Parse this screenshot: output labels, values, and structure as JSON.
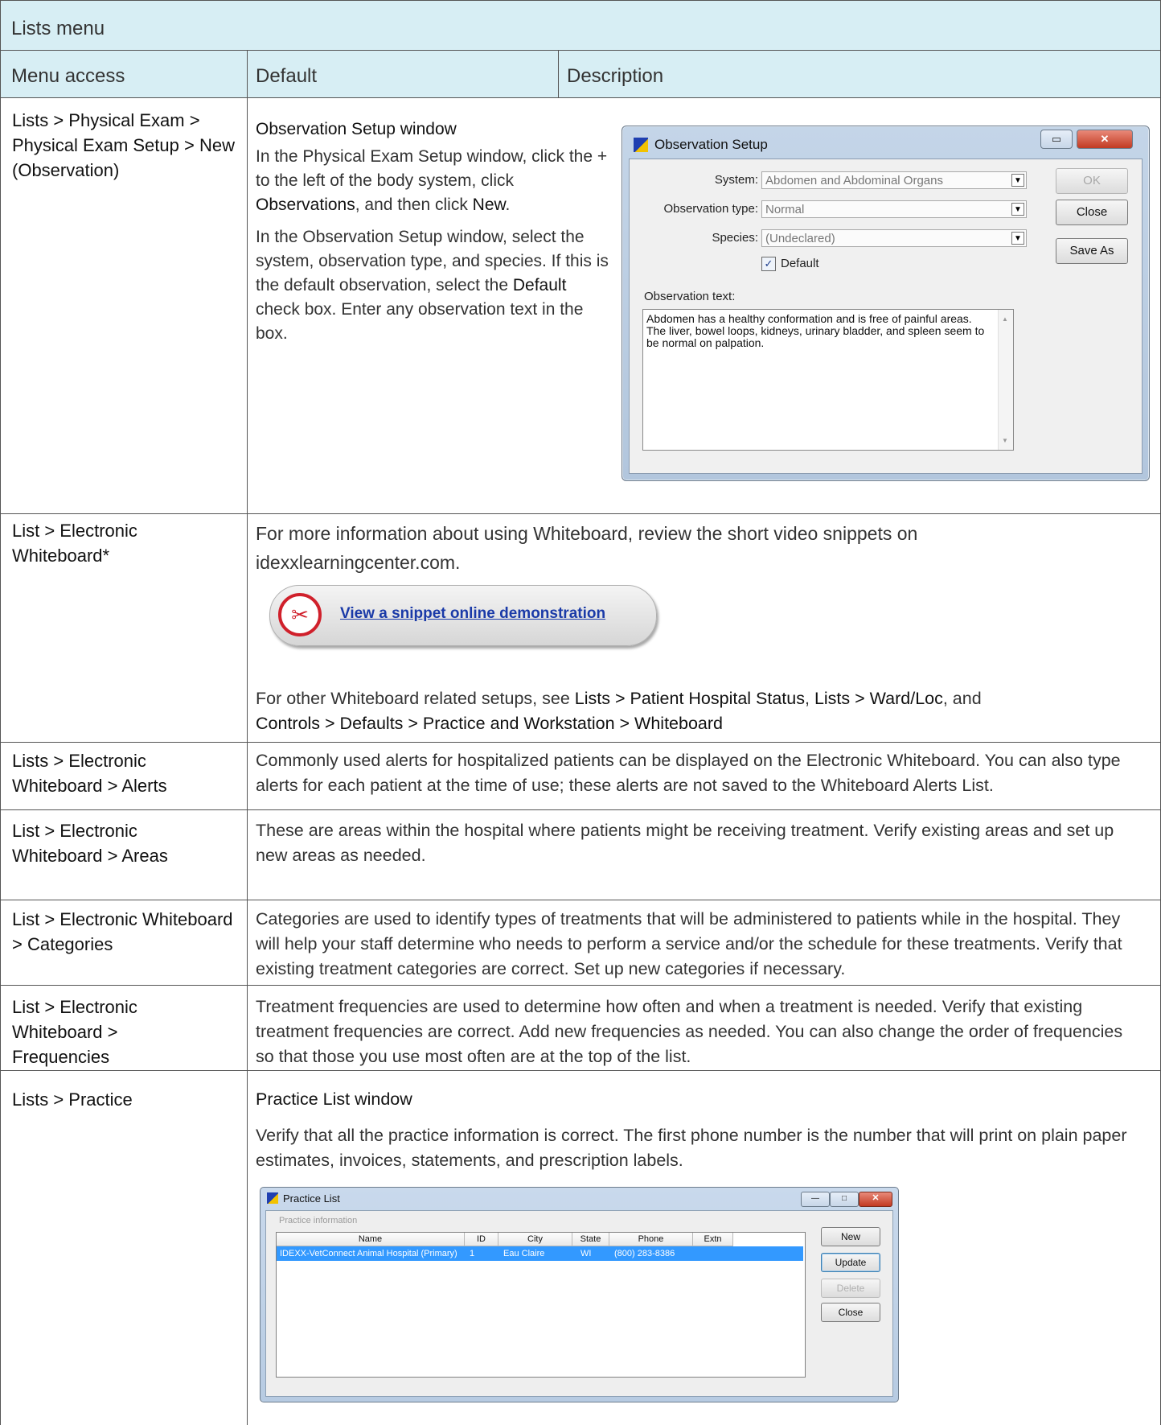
{
  "table": {
    "title": "Lists menu",
    "headers": [
      "Menu access",
      "Default",
      "Description"
    ]
  },
  "rows": {
    "obs": {
      "access": "Lists > Physical Exam > Physical Exam Setup > New (Observation)",
      "heading": "Observation Setup window",
      "p1_a": "In the Physical Exam Setup window, click the + to the left of the body system, click ",
      "p1_b": "Observations",
      "p1_c": ",  and then click ",
      "p1_d": "New",
      "p1_e": ".",
      "p2_a": "In the Observation Setup window, select the system, observation type, and species. If this is the default observation, select the ",
      "p2_b": "Default",
      "p2_c": " check box. Enter any observation text in the box."
    },
    "whiteboard": {
      "access": "List > Electronic Whiteboard*",
      "info": "For more information about using Whiteboard, review the short video snippets on idexxlearningcenter.com.",
      "snippet_link": "View a snippet online demonstration",
      "other_a": "For other Whiteboard related setups, see ",
      "other_b": "Lists > Patient Hospital Status",
      "other_c": ", ",
      "other_d": "Lists > Ward/Loc",
      "other_e": ", and",
      "other_f": "Controls > Defaults > Practice and Workstation > Whiteboard"
    },
    "alerts": {
      "access": "Lists > Electronic Whiteboard > Alerts",
      "text": "Commonly used alerts for hospitalized patients can be displayed on the Electronic Whiteboard. You can also type alerts for each patient at the time of use; these alerts are not saved to the Whiteboard Alerts List."
    },
    "areas": {
      "access": "List > Electronic Whiteboard > Areas",
      "text": "These are areas within the hospital where patients might be receiving treatment. Verify existing areas and set up new areas as needed."
    },
    "categories": {
      "access": "List > Electronic Whiteboard > Categories",
      "text": "Categories are used to identify types of treatments that will be administered to patients while in the hospital. They will help your staff determine who needs to perform a service and/or the schedule for these treatments. Verify that existing treatment categories are correct. Set up new categories if necessary."
    },
    "frequencies": {
      "access": "List > Electronic Whiteboard > Frequencies",
      "text": "Treatment frequencies are used to determine how often and when a treatment is needed. Verify that existing treatment frequencies are correct. Add new frequencies as needed. You can also change the order of frequencies so that those you use most often are at the top of the list."
    },
    "practice": {
      "access": "Lists > Practice",
      "heading": "Practice List window",
      "text": "Verify that all the practice information is correct. The first phone number is the number that will print on plain paper estimates, invoices, statements, and prescription labels."
    }
  },
  "observation_window": {
    "title": "Observation Setup",
    "system_label": "System:",
    "system_value": "Abdomen and Abdominal Organs",
    "type_label": "Observation type:",
    "type_value": "Normal",
    "species_label": "Species:",
    "species_value": "(Undeclared)",
    "default_label": "Default",
    "default_checked": true,
    "text_label": "Observation text:",
    "text_value": "Abdomen has a healthy conformation and is free of painful areas. The liver, bowel loops, kidneys, urinary bladder, and spleen seem to be normal on palpation.",
    "ok": "OK",
    "close": "Close",
    "save_as": "Save As"
  },
  "practice_window": {
    "title": "Practice List",
    "group_label": "Practice information",
    "columns": [
      "Name",
      "ID",
      "City",
      "State",
      "Phone",
      "Extn"
    ],
    "row": [
      "IDEXX-VetConnect Animal Hospital (Primary)",
      "1",
      "Eau Claire",
      "WI",
      "(800) 283-8386",
      ""
    ],
    "buttons": [
      "New",
      "Update",
      "Delete",
      "Close"
    ]
  },
  "colors": {
    "header_bg": "#d7eef4",
    "link": "#1a3aa8",
    "selection": "#3399ff"
  }
}
